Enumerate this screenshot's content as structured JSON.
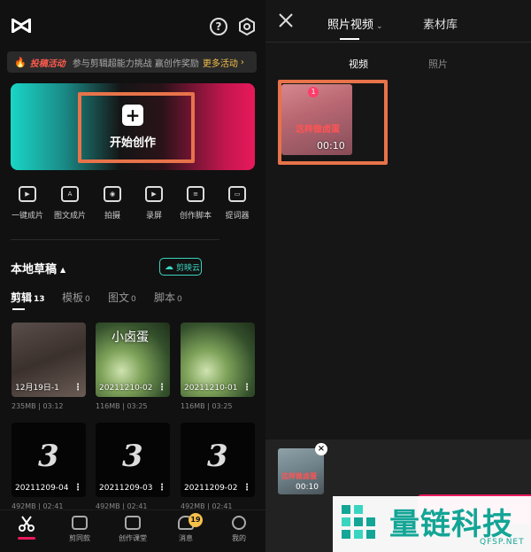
{
  "left": {
    "banner": {
      "tag": "投稿活动",
      "text": "参与剪辑超能力挑战 赢创作奖励",
      "more": "更多活动"
    },
    "create": {
      "plus": "+",
      "label": "开始创作"
    },
    "tools": [
      {
        "label": "一键成片",
        "glyph": "▶"
      },
      {
        "label": "图文成片",
        "glyph": "A"
      },
      {
        "label": "拍摄",
        "glyph": "◉"
      },
      {
        "label": "录屏",
        "glyph": "▶"
      },
      {
        "label": "创作脚本",
        "glyph": "≡"
      },
      {
        "label": "提词器",
        "glyph": "▭"
      }
    ],
    "drafts": {
      "title": "本地草稿",
      "cloud": "剪映云",
      "tabs": [
        {
          "label": "剪辑",
          "count": "13"
        },
        {
          "label": "模板",
          "count": "0"
        },
        {
          "label": "图文",
          "count": "0"
        },
        {
          "label": "脚本",
          "count": "0"
        }
      ],
      "items": [
        {
          "name": "12月19日-1",
          "meta": "235MB | 03:12",
          "overlay": ""
        },
        {
          "name": "20211210-02",
          "meta": "116MB | 03:25",
          "overlay": "小卤蛋"
        },
        {
          "name": "20211210-01",
          "meta": "116MB | 03:25",
          "overlay": ""
        },
        {
          "name": "20211209-04",
          "meta": "492MB | 02:41",
          "overlay": "3"
        },
        {
          "name": "20211209-03",
          "meta": "492MB | 02:41",
          "overlay": "3"
        },
        {
          "name": "20211209-02",
          "meta": "492MB | 02:41",
          "overlay": "3"
        }
      ]
    },
    "nav": [
      {
        "label": ""
      },
      {
        "label": "剪同款"
      },
      {
        "label": "创作课堂"
      },
      {
        "label": "消息",
        "badge": "19"
      },
      {
        "label": "我的"
      }
    ]
  },
  "right": {
    "tabs": [
      {
        "label": "照片视频"
      },
      {
        "label": "素材库"
      }
    ],
    "filters": [
      "视频",
      "照片"
    ],
    "media": {
      "badge": "1",
      "caption": "这样做卤蛋",
      "duration": "00:10"
    },
    "tray": {
      "caption": "这样做卤蛋",
      "duration": "00:10",
      "remove": "×"
    }
  },
  "watermark": {
    "cn": "量链科技",
    "en": "QFSP.NET"
  },
  "colors": {
    "accent": "#e8195b",
    "highlight": "#e8734a",
    "teal": "#3ad5c0",
    "badge": "#f5c04a"
  }
}
